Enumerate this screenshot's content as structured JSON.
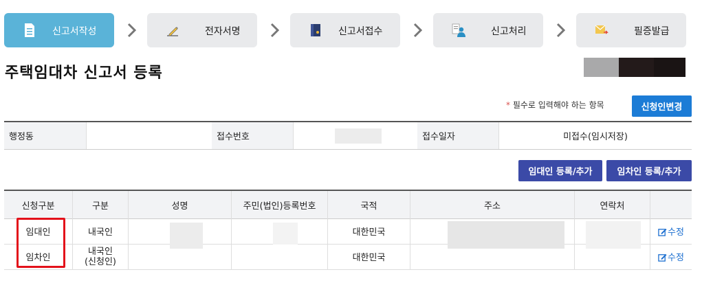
{
  "steps": [
    {
      "label": "신고서작성",
      "icon": "document-icon",
      "active": true
    },
    {
      "label": "전자서명",
      "icon": "pen-sign-icon",
      "active": false
    },
    {
      "label": "신고서접수",
      "icon": "folder-doc-icon",
      "active": false
    },
    {
      "label": "신고처리",
      "icon": "person-doc-icon",
      "active": false
    },
    {
      "label": "필증발급",
      "icon": "certificate-icon",
      "active": false
    }
  ],
  "page_title": "주택임대차 신고서 등록",
  "required_note": {
    "star": "*",
    "text": " 필수로 입력해야 하는 항목"
  },
  "buttons": {
    "change_applicant": "신청인변경",
    "add_lessor": "임대인 등록/추가",
    "add_lessee": "임차인 등록/추가"
  },
  "info": {
    "dong_label": "행정동",
    "dong_value": "",
    "receipt_no_label": "접수번호",
    "receipt_date_label": "접수일자",
    "receipt_date_value": "미접수(임시저장)"
  },
  "table": {
    "headers": [
      "신청구분",
      "구분",
      "성명",
      "주민(법인)등록번호",
      "국적",
      "주소",
      "연락처",
      ""
    ],
    "rows": [
      {
        "type": "임대인",
        "category": "내국인",
        "category2": "",
        "nationality": "대한민국",
        "action": "수정"
      },
      {
        "type": "임차인",
        "category": "내국인",
        "category2": "(신청인)",
        "nationality": "대한민국",
        "action": "수정"
      }
    ]
  },
  "colors": {
    "active_step": "#5ab3d8",
    "primary_button": "#1c7cd6",
    "navy_button": "#3b4aa7",
    "highlight": "#e3111a"
  }
}
